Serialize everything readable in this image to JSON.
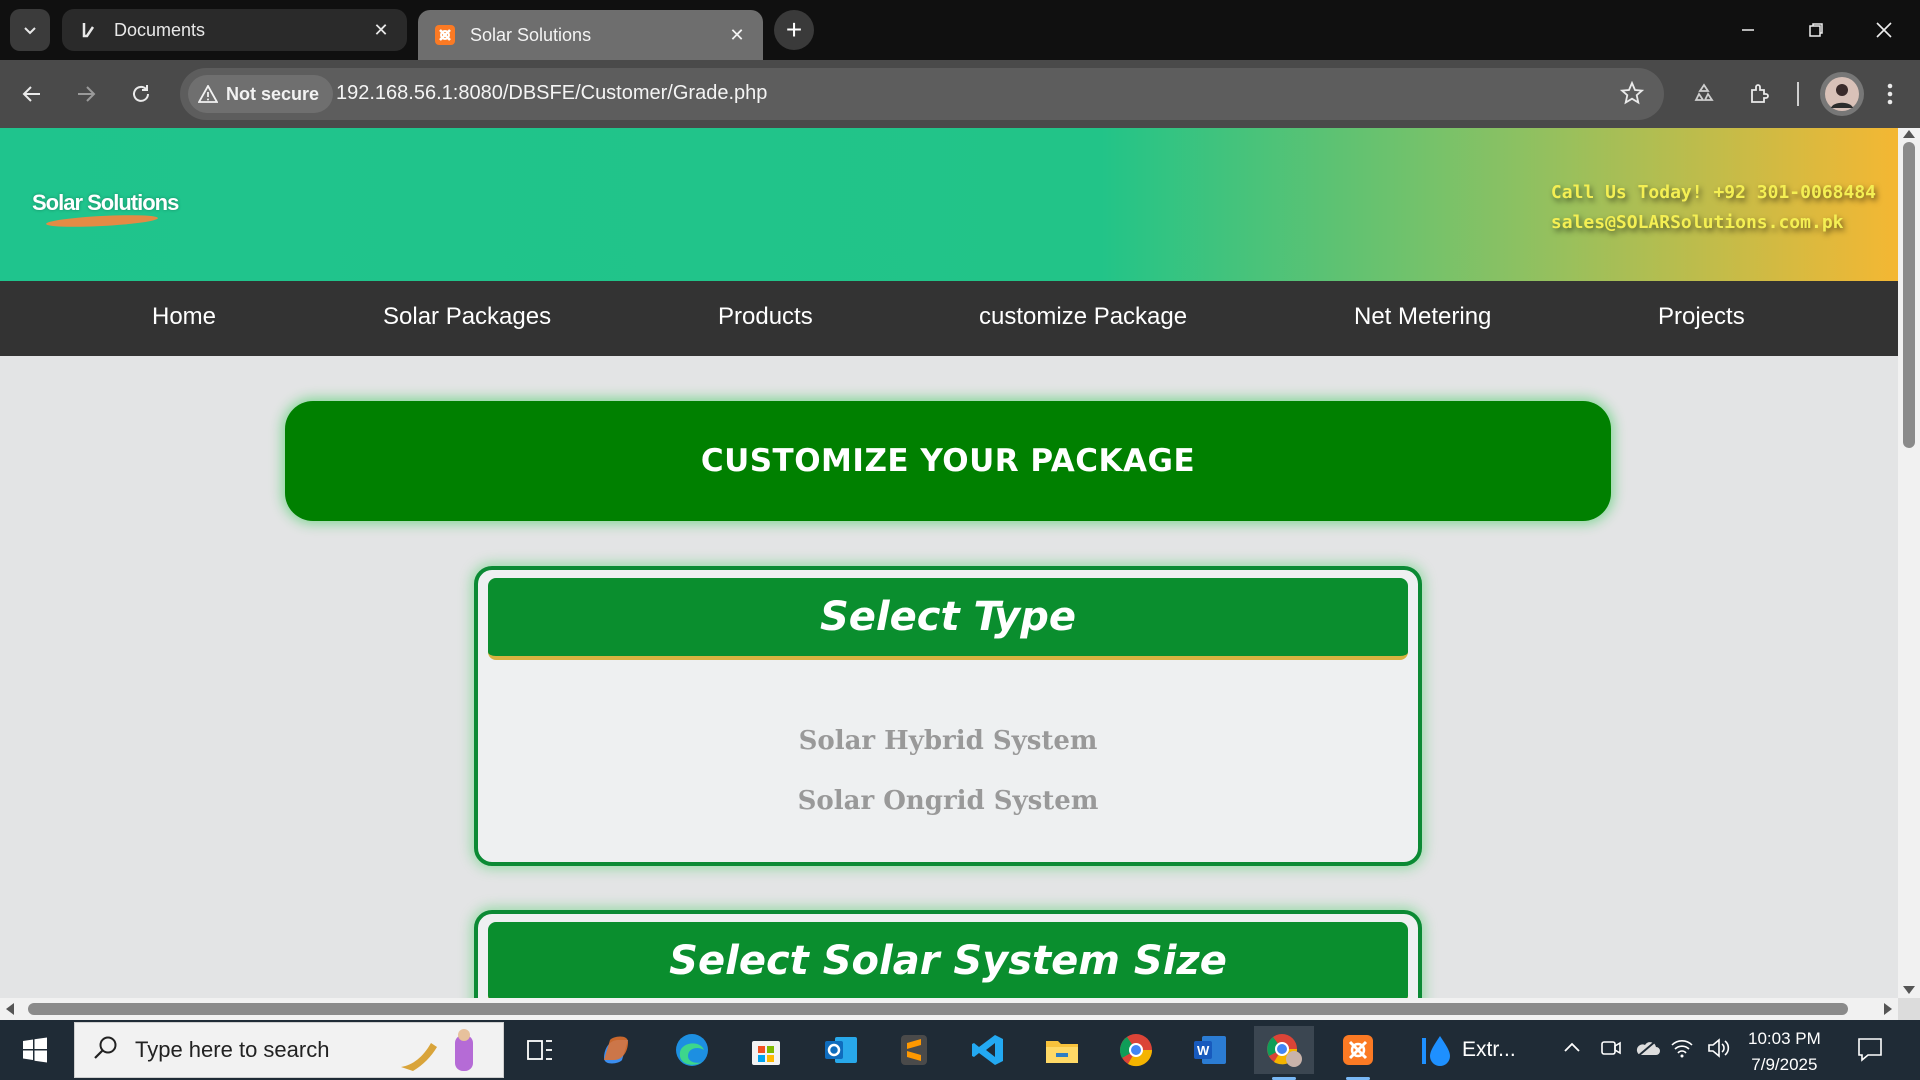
{
  "browser": {
    "tabs": [
      {
        "title": "Documents",
        "icon": "documents-favicon"
      },
      {
        "title": "Solar Solutions",
        "icon": "xampp-favicon"
      }
    ],
    "security_label": "Not secure",
    "url": "192.168.56.1:8080/DBSFE/Customer/Grade.php"
  },
  "site": {
    "logo_text": "Solar Solutions",
    "contact_phone": "Call Us Today! +92 301-0068484",
    "contact_email": "sales@SOLARSolutions.com.pk",
    "nav": [
      "Home",
      "Solar Packages",
      "Products",
      "customize Package",
      "Net Metering",
      "Projects"
    ],
    "banner": "CUSTOMIZE YOUR PACKAGE",
    "type_section": {
      "title": "Select Type",
      "options": [
        "Solar Hybrid System",
        "Solar Ongrid System"
      ]
    },
    "size_section": {
      "title": "Select Solar System Size"
    },
    "colors": {
      "header_start": "#1fc48d",
      "header_end": "#f4b733",
      "nav_bg": "#333333",
      "banner_bg": "#008000",
      "card_header_bg": "#0a8e2e",
      "contact_text": "#f4ef53"
    }
  },
  "taskbar": {
    "search_placeholder": "Type here to search",
    "extra_app_label": "Extr...",
    "time": "10:03 PM",
    "date": "7/9/2025"
  }
}
